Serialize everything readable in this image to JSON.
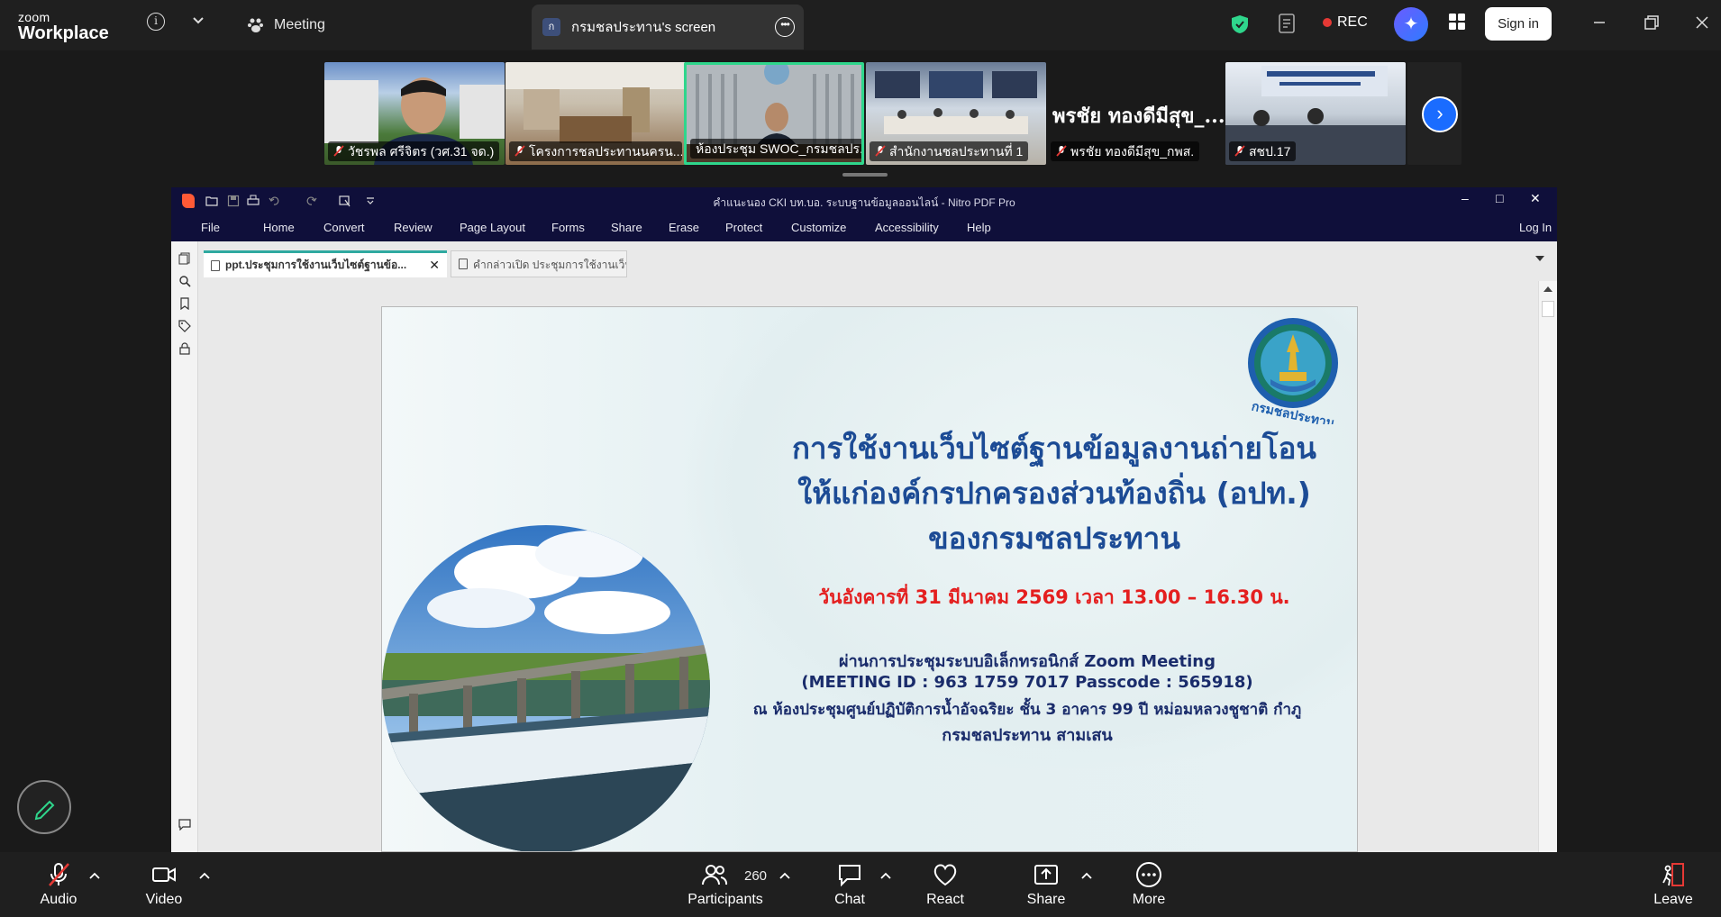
{
  "zoom": {
    "logo_line1": "zoom",
    "logo_line2": "Workplace",
    "meeting_label": "Meeting",
    "share_tab_avatar": "ก",
    "share_tab_label": "กรมชลประทาน's screen",
    "rec_label": "REC",
    "sign_in": "Sign in",
    "rec_color": "#e53935",
    "accent": "#1a6cff"
  },
  "participants": [
    {
      "name": "วัชรพล ศรีจิตร (วศ.31 จด.)",
      "muted": true
    },
    {
      "name": "โครงการชลประทานนครน...",
      "muted": true
    },
    {
      "name": "ห้องประชุม SWOC_กรมชลปร...",
      "muted": false,
      "active": true
    },
    {
      "name": "สำนักงานชลประทานที่ 1",
      "muted": true
    },
    {
      "name": "พรชัย ทองดีมีสุข_กพส.",
      "muted": true,
      "display_name": "พรชัย ทองดีมีสุข_..."
    },
    {
      "name": "สชป.17",
      "muted": true
    }
  ],
  "nitro": {
    "window_title": "คำแนะนอง CKI บท.บอ. ระบบฐานข้อมูลออนไลน์ - Nitro PDF Pro",
    "menu": [
      "File",
      "Home",
      "Convert",
      "Review",
      "Page Layout",
      "Forms",
      "Share",
      "Erase",
      "Protect",
      "Customize",
      "Accessibility",
      "Help"
    ],
    "login": "Log In",
    "tabs": [
      "ppt.ประชุมการใช้งานเว็บไซต์ฐานข้อ...",
      "คำกล่าวเปิด ประชุมการใช้งานเว็บไซ..."
    ]
  },
  "slide": {
    "seal_text": "กรมชลประทาน",
    "title_line1": "การใช้งานเว็บไซต์ฐานข้อมูลงานถ่ายโอน",
    "title_line2": "ให้แก่องค์กรปกครองส่วนท้องถิ่น (อปท.)",
    "title_line3": "ของกรมชลประทาน",
    "date": "วันอังคารที่ 31 มีนาคม 2569 เวลา 13.00 – 16.30 น.",
    "via": "ผ่านการประชุมระบบอิเล็กทรอนิกส์ Zoom Meeting",
    "meeting_id": "(MEETING ID : 963 1759 7017 Passcode : 565918)",
    "venue": "ณ ห้องประชุมศูนย์ปฏิบัติการน้ำอัจฉริยะ ชั้น 3 อาคาร 99 ปี หม่อมหลวงชูชาติ กำภู",
    "venue2": "กรมชลประทาน สามเสน"
  },
  "toolbar": {
    "audio": "Audio",
    "video": "Video",
    "participants": "Participants",
    "participants_count": "260",
    "chat": "Chat",
    "react": "React",
    "share": "Share",
    "more": "More",
    "leave": "Leave"
  }
}
